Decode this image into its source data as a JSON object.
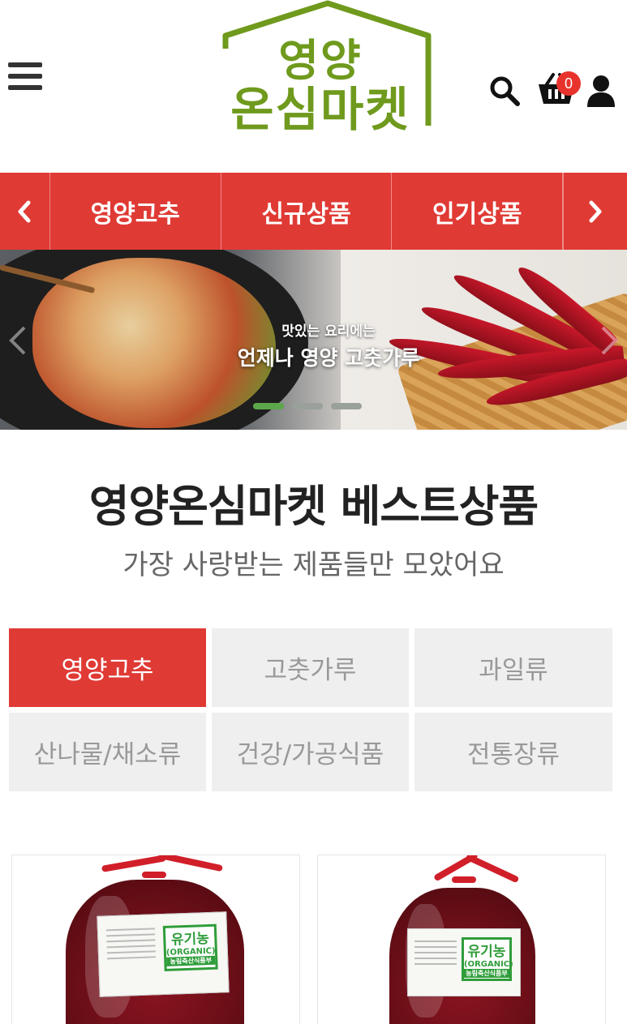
{
  "header": {
    "logo_line1": "영양",
    "logo_line2": "온심마켓",
    "cart_count": "0"
  },
  "nav": {
    "items": [
      {
        "label": "영양고추"
      },
      {
        "label": "신규상품"
      },
      {
        "label": "인기상품"
      }
    ]
  },
  "banner": {
    "line1": "맛있는 요리에는",
    "line2": "언제나 영양 고춧가루",
    "slides": 3,
    "active_slide": 1
  },
  "best": {
    "title": "영양온심마켓 베스트상품",
    "subtitle": "가장 사랑받는 제품들만 모았어요"
  },
  "tabs": [
    {
      "label": "영양고추",
      "active": true
    },
    {
      "label": "고춧가루",
      "active": false
    },
    {
      "label": "과일류",
      "active": false
    },
    {
      "label": "산나물/채소류",
      "active": false
    },
    {
      "label": "건강/가공식품",
      "active": false
    },
    {
      "label": "전통장류",
      "active": false
    }
  ],
  "products": [
    {
      "badge_title": "유기농",
      "badge_en": "(ORGANIC)",
      "badge_org": "농림축산식품부"
    },
    {
      "badge_title": "유기농",
      "badge_en": "(ORGANIC)",
      "badge_org": "농림축산식품부"
    }
  ],
  "colors": {
    "accent": "#e03a35",
    "logo_green": "#6f9a1d",
    "tab_inactive": "#efefef",
    "organic_green": "#2f9d3a"
  }
}
